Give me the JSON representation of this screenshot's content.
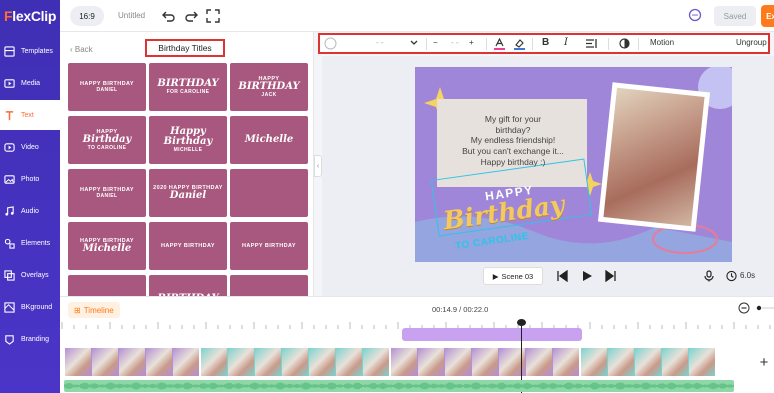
{
  "brand": {
    "logo_f": "F",
    "logo_rest": "lexClip"
  },
  "sidebar": {
    "items": [
      {
        "label": "Templates"
      },
      {
        "label": "Media"
      },
      {
        "label": "Text"
      },
      {
        "label": "Video"
      },
      {
        "label": "Photo"
      },
      {
        "label": "Audio"
      },
      {
        "label": "Elements"
      },
      {
        "label": "Overlays"
      },
      {
        "label": "BKground"
      },
      {
        "label": "Branding"
      }
    ]
  },
  "topbar": {
    "ratio": "16:9",
    "project_title": "Untitled",
    "saved": "Saved",
    "export": "Ex"
  },
  "panel": {
    "back": "Back",
    "title": "Birthday Titles",
    "thumbs": [
      {
        "l1": "HAPPY BIRTHDAY",
        "l2": "",
        "l3": "DANIEL"
      },
      {
        "l1": "",
        "l2": "BIRTHDAY",
        "l3": "FOR CAROLINE"
      },
      {
        "l1": "HAPPY",
        "l2": "BIRTHDAY",
        "l3": "JACK"
      },
      {
        "l1": "HAPPY",
        "l2": "Birthday",
        "l3": "TO CAROLINE"
      },
      {
        "l1": "",
        "l2": "Happy Birthday",
        "l3": "MICHELLE"
      },
      {
        "l1": "",
        "l2": "Michelle",
        "l3": ""
      },
      {
        "l1": "HAPPY BIRTHDAY",
        "l2": "",
        "l3": "DANIEL"
      },
      {
        "l1": "2020 HAPPY BIRTHDAY",
        "l2": "Daniel",
        "l3": ""
      },
      {
        "l1": "",
        "l2": "",
        "l3": ""
      },
      {
        "l1": "HAPPY BIRTHDAY",
        "l2": "Michelle",
        "l3": ""
      },
      {
        "l1": "HAPPY BIRTHDAY",
        "l2": "",
        "l3": ""
      },
      {
        "l1": "HAPPY BIRTHDAY",
        "l2": "",
        "l3": ""
      },
      {
        "l1": "",
        "l2": "",
        "l3": ""
      },
      {
        "l1": "",
        "l2": "BIRTHDAY",
        "l3": ""
      },
      {
        "l1": "",
        "l2": "",
        "l3": ""
      }
    ]
  },
  "format": {
    "font": "- -",
    "size": "- -",
    "motion": "Motion",
    "ungroup": "Ungroup"
  },
  "canvas": {
    "gift_lines": [
      "My gift for your",
      "birthday?",
      "My endless friendship!",
      "But you can't exchange it...",
      "Happy birthday :)"
    ],
    "happy": "HAPPY",
    "birthday": "Birthday",
    "to_caroline": "TO CAROLINE"
  },
  "player": {
    "scene": "Scene 03",
    "duration": "6.0s"
  },
  "timeline": {
    "label": "Timeline",
    "time": "00:14.9 / 00:22.0"
  },
  "colors": {
    "sidebar": "#4a35c8",
    "accent": "#ff7a1a",
    "thumb": "#a8577e",
    "canvas": "#9f86d8",
    "highlight": "#d33333"
  }
}
